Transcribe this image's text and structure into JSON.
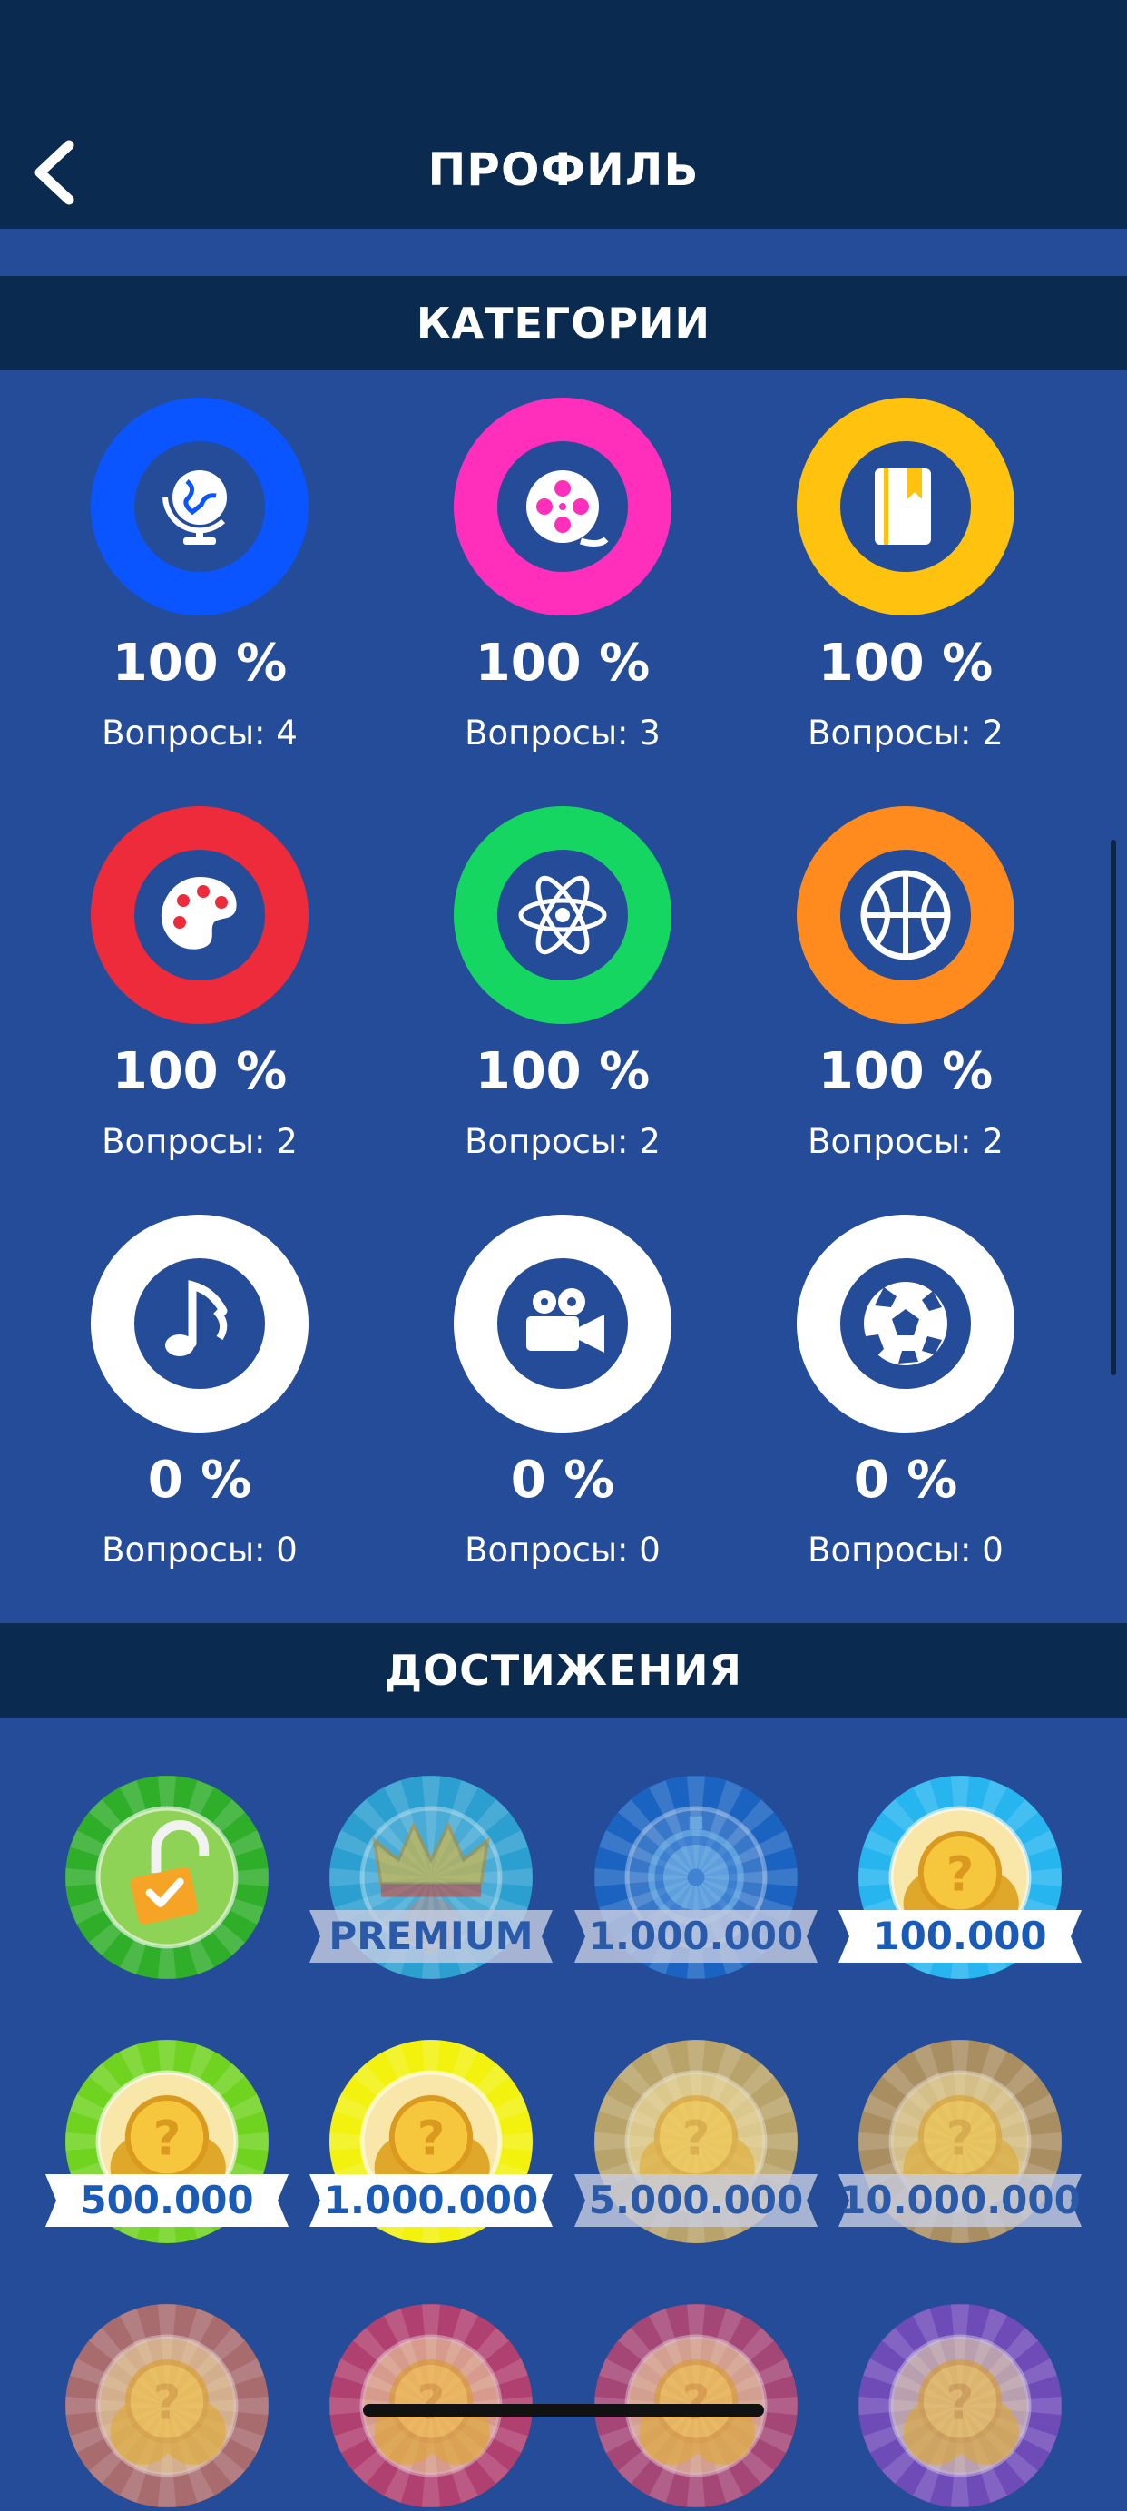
{
  "header": {
    "title": "ПРОФИЛЬ",
    "back_icon": "chevron-left-icon"
  },
  "sections": {
    "categories_title": "КАТЕГОРИИ",
    "achievements_title": "ДОСТИЖЕНИЯ"
  },
  "categories": [
    {
      "icon": "globe-icon",
      "color": "#0a55ff",
      "percent": "100 %",
      "questions": "Вопросы: 4"
    },
    {
      "icon": "film-reel-icon",
      "color": "#ff2fbc",
      "percent": "100 %",
      "questions": "Вопросы: 3"
    },
    {
      "icon": "book-icon",
      "color": "#ffc20e",
      "percent": "100 %",
      "questions": "Вопросы: 2"
    },
    {
      "icon": "palette-icon",
      "color": "#ee2b3b",
      "percent": "100 %",
      "questions": "Вопросы: 2"
    },
    {
      "icon": "atom-icon",
      "color": "#15d660",
      "percent": "100 %",
      "questions": "Вопросы: 2"
    },
    {
      "icon": "basketball-icon",
      "color": "#ff8a1e",
      "percent": "100 %",
      "questions": "Вопросы: 2"
    },
    {
      "icon": "music-note-icon",
      "color": "#ffffff",
      "percent": "0 %",
      "questions": "Вопросы: 0"
    },
    {
      "icon": "movie-camera-icon",
      "color": "#ffffff",
      "percent": "0 %",
      "questions": "Вопросы: 0"
    },
    {
      "icon": "soccer-ball-icon",
      "color": "#ffffff",
      "percent": "0 %",
      "questions": "Вопросы: 0"
    }
  ],
  "achievements": [
    {
      "icon": "unlocked-padlock-icon",
      "label": "",
      "color": "#2fae2a",
      "unlocked": true
    },
    {
      "icon": "crown-icon",
      "label": "PREMIUM",
      "color": "#2b9fd0",
      "unlocked": false
    },
    {
      "icon": "stopwatch-icon",
      "label": "1.000.000",
      "color": "#1a63c0",
      "unlocked": false
    },
    {
      "icon": "coins-icon",
      "label": "100.000",
      "color": "#26b5ef",
      "unlocked": true
    },
    {
      "icon": "coins-icon",
      "label": "500.000",
      "color": "#6fd31f",
      "unlocked": true
    },
    {
      "icon": "coins-icon",
      "label": "1.000.000",
      "color": "#f2f20e",
      "unlocked": true
    },
    {
      "icon": "coins-icon",
      "label": "5.000.000",
      "color": "#b8a36a",
      "unlocked": false
    },
    {
      "icon": "coins-icon",
      "label": "10.000.000",
      "color": "#a98e62",
      "unlocked": false
    },
    {
      "icon": "coins-icon",
      "label": "",
      "color": "#a86b6e",
      "unlocked": false
    },
    {
      "icon": "coins-icon",
      "label": "",
      "color": "#b0406f",
      "unlocked": false
    },
    {
      "icon": "coins-icon",
      "label": "",
      "color": "#a54776",
      "unlocked": false
    },
    {
      "icon": "coins-icon",
      "label": "",
      "color": "#6f4bb8",
      "unlocked": false
    }
  ]
}
